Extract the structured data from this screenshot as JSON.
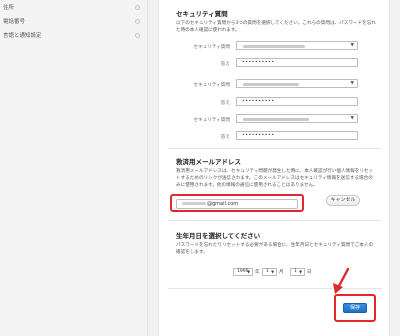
{
  "sidebar": {
    "items": [
      {
        "label": "住所"
      },
      {
        "label": "電話番号"
      },
      {
        "label": "言語と通知設定"
      }
    ]
  },
  "security_questions": {
    "title": "セキュリティ質問",
    "description": "以下のセキュリティ質問から3つの質問を選択してください。これらの質問は、パスワードを忘れた時の本人確認に使われます。",
    "question_label": "セキュリティ質問",
    "answer_label": "答え",
    "answer_mask": "••••••••••"
  },
  "rescue_email": {
    "title": "救済用メールアドレス",
    "description": "救済用メールアドレスは、セキュリティ問題が発生した時に、本人確認が行い個人情報をリセットするためのリンクが送信されます。このメールアドレスはセキュリティ情報を送信する場合のみに使用されます。他の情報の通信に使用されることはありません。",
    "email_value": "@gmail.com",
    "cancel_label": "キャンセル"
  },
  "birthday": {
    "title": "生年月日を選択してください",
    "description": "パスワードを忘れたりリセットする必要がある場合に、生年月日とセキュリティ質問でご本人の確認をします。",
    "year": "1990",
    "month": "1",
    "day": "1",
    "year_unit": "年",
    "month_unit": "月",
    "day_unit": "日"
  },
  "actions": {
    "save_label": "保存"
  },
  "annotation_color": "#e0282d"
}
